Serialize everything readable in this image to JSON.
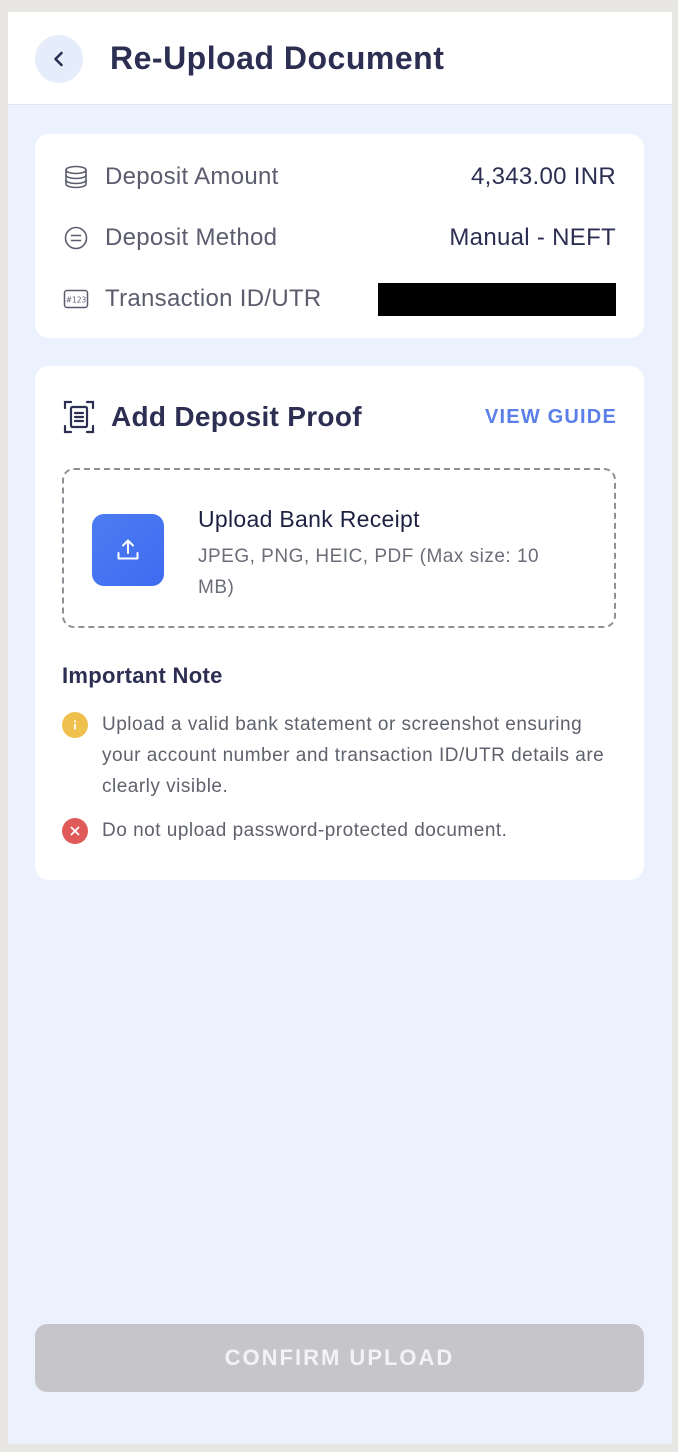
{
  "header": {
    "title": "Re-Upload Document",
    "back_icon": "chevron-left-icon"
  },
  "deposit_info": {
    "rows": [
      {
        "label": "Deposit Amount",
        "value": "4,343.00 INR",
        "icon": "coins-stack-icon"
      },
      {
        "label": "Deposit Method",
        "value": "Manual - NEFT",
        "icon": "list-circle-icon"
      },
      {
        "label": "Transaction ID/UTR",
        "value": "",
        "icon": "hash-123-icon"
      }
    ]
  },
  "proof": {
    "title": "Add Deposit Proof",
    "view_guide_label": "VIEW GUIDE",
    "upload_title": "Upload Bank Receipt",
    "upload_formats": "JPEG, PNG, HEIC, PDF (Max size: 10 MB)",
    "note_title": "Important Note",
    "notes": [
      {
        "text": "Upload a valid bank statement or screenshot ensuring your account number and transaction ID/UTR details are clearly visible.",
        "type": "info",
        "color": "#f0c04f"
      },
      {
        "text": "Do not upload password-protected document.",
        "type": "error",
        "color": "#e05a5a"
      }
    ]
  },
  "footer": {
    "confirm_label": "CONFIRM UPLOAD",
    "confirm_disabled": true
  },
  "colors": {
    "accent": "#5b7fe8",
    "upload_tile": "#4675f1",
    "page_bg": "#ecf2fd",
    "disabled_button": "#c5c5ca"
  }
}
